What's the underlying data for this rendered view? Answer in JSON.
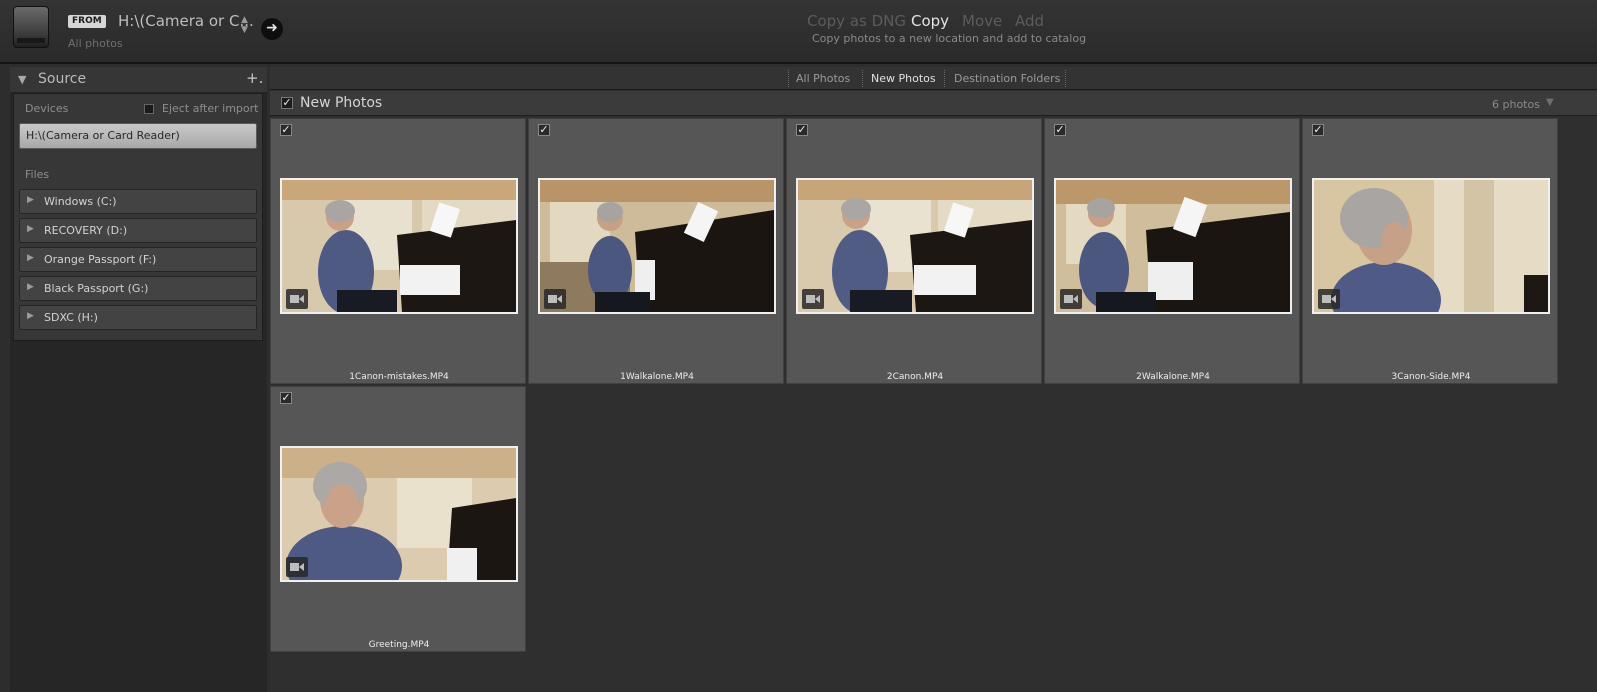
{
  "topbar": {
    "from_badge": "FROM",
    "source_name": "H:\\(Camera or C...",
    "source_toggle_icon": "up-down-chevron-icon",
    "source_subtitle": "All photos",
    "modes": [
      "Copy as DNG",
      "Copy",
      "Move",
      "Add"
    ],
    "active_mode": "Copy",
    "mode_description": "Copy photos to a new location and add to catalog"
  },
  "sidebar": {
    "title": "Source",
    "add_glyph": "+.",
    "devices_label": "Devices",
    "eject_label": "Eject after import",
    "eject_checked": false,
    "device": "H:\\(Camera or Card Reader)",
    "files_label": "Files",
    "volumes": [
      "Windows (C:)",
      "RECOVERY (D:)",
      "Orange Passport  (F:)",
      "Black Passport (G:)",
      "SDXC (H:)"
    ]
  },
  "main": {
    "filters": [
      "All Photos",
      "New Photos",
      "Destination Folders"
    ],
    "active_filter": "New Photos",
    "section_title": "New Photos",
    "photo_count": "6 photos",
    "items": [
      {
        "filename": "1Canon-mistakes.MP4",
        "checked": true,
        "kind": "video"
      },
      {
        "filename": "1Walkalone.MP4",
        "checked": true,
        "kind": "video"
      },
      {
        "filename": "2Canon.MP4",
        "checked": true,
        "kind": "video"
      },
      {
        "filename": "2Walkalone.MP4",
        "checked": true,
        "kind": "video"
      },
      {
        "filename": "3Canon-Side.MP4",
        "checked": true,
        "kind": "video"
      },
      {
        "filename": "Greeting.MP4",
        "checked": true,
        "kind": "video"
      }
    ]
  },
  "colors": {
    "background": "#2d2d2d",
    "cell": "#565656",
    "active_text": "#e4e4e4",
    "inactive_mode": "#5c5c5c"
  }
}
